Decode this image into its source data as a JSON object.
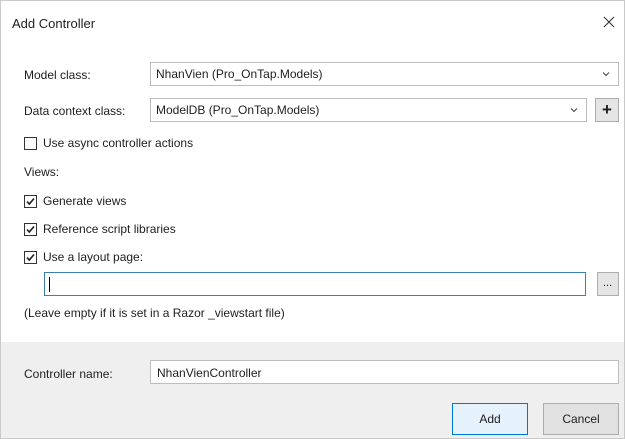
{
  "dialog": {
    "title": "Add Controller"
  },
  "model_class": {
    "label": "Model class:",
    "value": "NhanVien (Pro_OnTap.Models)"
  },
  "data_context_class": {
    "label": "Data context class:",
    "value": "ModelDB (Pro_OnTap.Models)",
    "add_label": "+"
  },
  "options": {
    "use_async": {
      "label": "Use async controller actions",
      "checked": false
    }
  },
  "views": {
    "heading": "Views:",
    "generate_views": {
      "label": "Generate views",
      "checked": true
    },
    "reference_scripts": {
      "label": "Reference script libraries",
      "checked": true
    },
    "use_layout": {
      "label": "Use a layout page:",
      "checked": true
    },
    "layout_path": "",
    "browse_label": "...",
    "hint": "(Leave empty if it is set in a Razor _viewstart file)"
  },
  "controller": {
    "label": "Controller name:",
    "value": "NhanVienController"
  },
  "buttons": {
    "add": "Add",
    "cancel": "Cancel"
  },
  "colors": {
    "footer_bg": "#efefef",
    "primary_border": "#0078d7",
    "focus_border": "#3c7fb1"
  }
}
